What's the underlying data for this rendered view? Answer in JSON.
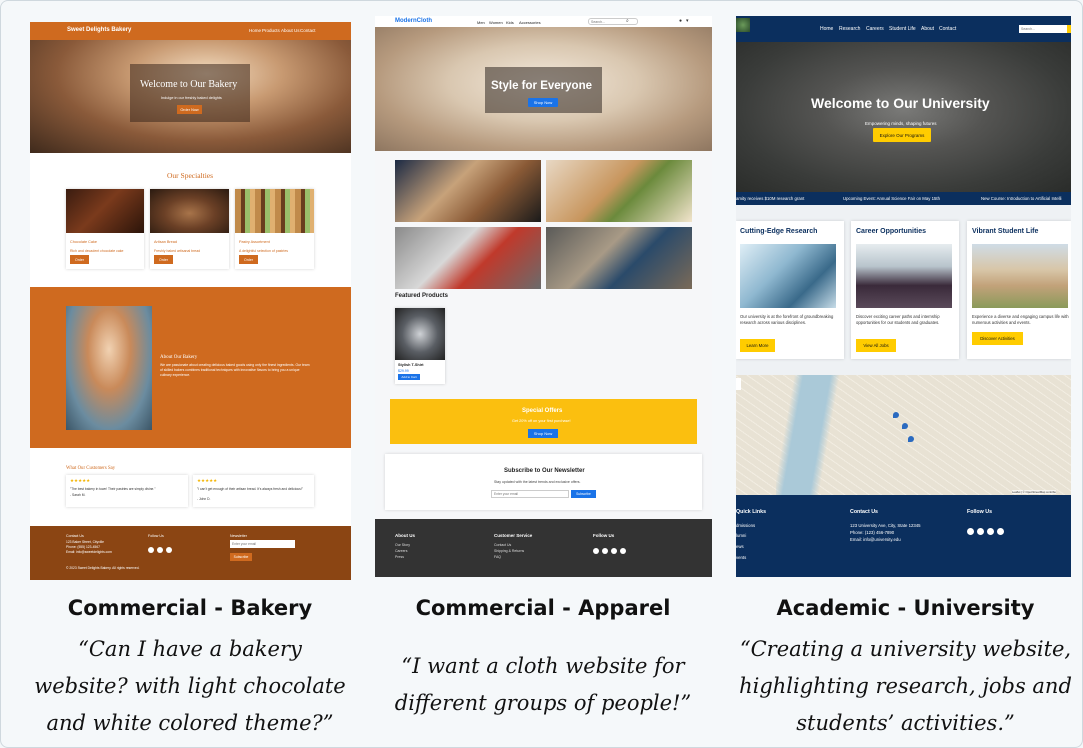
{
  "bakery": {
    "brand": "Sweet Delights Bakery",
    "nav": [
      "Home",
      "Products",
      "About Us",
      "Contact"
    ],
    "hero_title": "Welcome to Our Bakery",
    "hero_sub": "Indulge in our freshly baked delights",
    "hero_btn": "Order Now",
    "specialties_title": "Our Specialties",
    "cards": [
      {
        "name": "Chocolate Cake",
        "desc": "Rich and decadent chocolate cake",
        "btn": "Order"
      },
      {
        "name": "Artisan Bread",
        "desc": "Freshly baked artisanal bread",
        "btn": "Order"
      },
      {
        "name": "Pastry Assortment",
        "desc": "A delightful selection of pastries",
        "btn": "Order"
      }
    ],
    "about_title": "About Our Bakery",
    "about_text": "We are passionate about creating delicious baked goods using only the finest ingredients. Our team of skilled bakers combines traditional techniques with innovative flavors to bring you a unique culinary experience.",
    "reviews_title": "What Our Customers Say",
    "reviews": [
      {
        "stars": "★★★★★",
        "text": "\"The best bakery in town! Their pastries are simply divine.\"",
        "author": "- Sarah M."
      },
      {
        "stars": "★★★★★",
        "text": "\"I can't get enough of their artisan bread. It's always fresh and delicious!\"",
        "author": "- John D."
      }
    ],
    "footer": {
      "contact_title": "Contact Us",
      "address": "123 Baker Street, Cityville",
      "phone": "Phone: (555) 123-4567",
      "email": "Email: info@sweetdelights.com",
      "follow_title": "Follow Us",
      "news_title": "Newsletter",
      "news_placeholder": "Enter your email",
      "news_btn": "Subscribe",
      "copyright": "© 2023 Sweet Delights Bakery. All rights reserved."
    },
    "colors": {
      "brand": "#cf6a1f",
      "dark": "#8b4513"
    }
  },
  "apparel": {
    "brand": "ModernCloth",
    "nav": [
      "Men",
      "Women",
      "Kids",
      "Accessories"
    ],
    "search_placeholder": "Search...",
    "hero_title": "Style for Everyone",
    "hero_btn": "Shop Now",
    "featured_title": "Featured Products",
    "product": {
      "name": "Stylish T-Shirt",
      "price": "$29.99",
      "btn": "Add to Cart"
    },
    "offers_title": "Special Offers",
    "offers_text": "Get 20% off on your first purchase!",
    "offers_btn": "Shop Now",
    "newsletter_title": "Subscribe to Our Newsletter",
    "newsletter_text": "Stay updated with the latest trends and exclusive offers.",
    "newsletter_placeholder": "Enter your email",
    "newsletter_btn": "Subscribe",
    "footer": {
      "about_title": "About Us",
      "about_links": [
        "Our Story",
        "Careers",
        "Press"
      ],
      "service_title": "Customer Service",
      "service_links": [
        "Contact Us",
        "Shipping & Returns",
        "FAQ"
      ],
      "follow_title": "Follow Us"
    },
    "colors": {
      "brand": "#1a73e8",
      "offer": "#fbbf0f",
      "footer": "#333333"
    }
  },
  "university": {
    "nav": [
      "Home",
      "Research",
      "Careers",
      "Student Life",
      "About",
      "Contact"
    ],
    "search_placeholder": "Search...",
    "hero_title": "Welcome to Our University",
    "hero_sub": "Empowering minds, shaping futures",
    "hero_btn": "Explore Our Programs",
    "ticker": [
      "amity receives $10M research grant",
      "Upcoming Event: Annual Science Fair on May 15th",
      "New Course: Introduction to Artificial Intelli"
    ],
    "cards": [
      {
        "title": "Cutting-Edge Research",
        "text": "Our university is at the forefront of groundbreaking research across various disciplines.",
        "btn": "Learn More"
      },
      {
        "title": "Career Opportunities",
        "text": "Discover exciting career paths and internship opportunities for our students and graduates.",
        "btn": "View All Jobs"
      },
      {
        "title": "Vibrant Student Life",
        "text": "Experience a diverse and engaging campus life with numerous activities and events.",
        "btn": "Discover Activities"
      }
    ],
    "map_credit": "Leaflet | © OpenStreetMap contribu",
    "footer": {
      "links_title": "Quick Links",
      "links": [
        "dmissions",
        "lumni",
        "ews",
        "vents"
      ],
      "contact_title": "Contact Us",
      "address": "123 University Ave, City, State 12345",
      "phone": "Phone: (123) 456-7890",
      "email": "Email: info@university.edu",
      "follow_title": "Follow Us"
    },
    "colors": {
      "navy": "#0b2f5e",
      "gold": "#ffcc00"
    }
  },
  "captions": [
    {
      "title": "Commercial - Bakery",
      "quote_lines": [
        "“Can I have a bakery",
        "website? with light chocolate",
        "and white colored theme?”"
      ]
    },
    {
      "title": "Commercial - Apparel",
      "quote_lines": [
        "“I want a cloth website for",
        "different groups of people!”"
      ]
    },
    {
      "title": "Academic - University",
      "quote_lines": [
        "“Creating a university website,",
        "highlighting research, jobs and",
        "students’ activities.”"
      ]
    }
  ]
}
